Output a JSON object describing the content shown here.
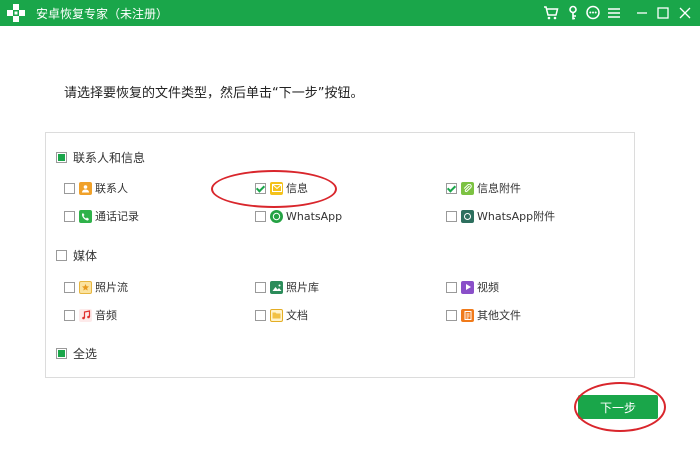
{
  "titlebar": {
    "title": "安卓恢复专家（未注册）",
    "icons": [
      "cart-icon",
      "key-icon",
      "chat-icon",
      "menu-icon",
      "minimize-icon",
      "maximize-icon",
      "close-icon"
    ],
    "minimize_glyph": "—",
    "maximize_glyph": "☐",
    "close_glyph": "✕",
    "menu_glyph": "≡"
  },
  "instruction": "请选择要恢复的文件类型，然后单击“下一步”按钮。",
  "sections": {
    "contacts_messages": {
      "label": "联系人和信息",
      "state": "partial",
      "items": [
        {
          "label": "联系人",
          "checked": false,
          "icon": "contacts-icon"
        },
        {
          "label": "信息",
          "checked": true,
          "icon": "messages-icon"
        },
        {
          "label": "信息附件",
          "checked": true,
          "icon": "message-attachments-icon"
        },
        {
          "label": "通话记录",
          "checked": false,
          "icon": "call-log-icon"
        },
        {
          "label": "WhatsApp",
          "checked": false,
          "icon": "whatsapp-icon"
        },
        {
          "label": "WhatsApp附件",
          "checked": false,
          "icon": "whatsapp-attachments-icon"
        }
      ]
    },
    "media": {
      "label": "媒体",
      "state": "unchecked",
      "items": [
        {
          "label": "照片流",
          "checked": false,
          "icon": "photo-stream-icon"
        },
        {
          "label": "照片库",
          "checked": false,
          "icon": "photo-library-icon"
        },
        {
          "label": "视频",
          "checked": false,
          "icon": "video-icon"
        },
        {
          "label": "音频",
          "checked": false,
          "icon": "audio-icon"
        },
        {
          "label": "文档",
          "checked": false,
          "icon": "document-icon"
        },
        {
          "label": "其他文件",
          "checked": false,
          "icon": "other-files-icon"
        }
      ]
    }
  },
  "select_all": {
    "label": "全选",
    "state": "partial"
  },
  "next_button": "下一步",
  "colors": {
    "brand_green": "#1aa64a",
    "annotation_red": "#d9262c"
  }
}
